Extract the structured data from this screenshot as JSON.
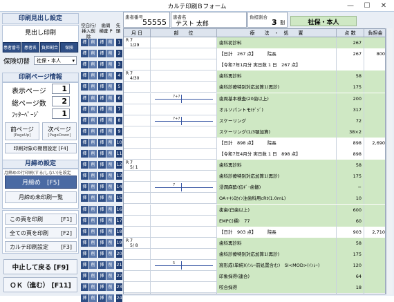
{
  "window": {
    "title": "カルテ印刷Ｂフォーム",
    "minimize": "—",
    "maximize": "☐",
    "close": "✕"
  },
  "left": {
    "sec1_title": "印刷見出し設定",
    "heading_print": "見出し印刷",
    "tabs": [
      "患者番号",
      "患者名",
      "負担割合",
      "保険"
    ],
    "insurance_switch_label": "保険切替",
    "insurance_value": "社保・本人",
    "sec2_title": "印刷ページ情報",
    "display_page_label": "表示ページ",
    "display_page": "1",
    "total_pages_label": "総ページ数",
    "total_pages": "2",
    "footer_page_label": "ﾌｯﾀｰﾍﾟｰｼﾞ",
    "footer_page": "1",
    "prev_label": "前ページ",
    "next_label": "次ページ",
    "prev_key": "[PageUp]",
    "next_key": "[PageDown]",
    "period_label": "印刷対象の期間設定 [F4]",
    "sec3_title": "月締め設定",
    "sec3_note": "月締めの行印刷(する/しない)を設定",
    "month_close": "月締め　[F5]",
    "month_close_list": "月締め未印刷一覧",
    "print_this": "この頁を印刷",
    "print_this_key": "[F1]",
    "print_all": "全ての頁を印刷",
    "print_all_key": "[F2]",
    "print_settings": "カルテ印刷設定",
    "print_settings_key": "[F3]",
    "cancel": "中止して戻る [F9]",
    "ok": "ＯＫ（進む） [F11]"
  },
  "side_header": {
    "blank_row": "空白行/",
    "insert_delete": "挿入削除",
    "tooth": "歯周",
    "check": "検査 P",
    "first_exam": "先 頭"
  },
  "side_buttons": {
    "insert": "挿",
    "delete": "削"
  },
  "patient": {
    "number_caption": "患者番号",
    "number": "55555",
    "name_caption": "患者名",
    "name": "テスト 太郎",
    "ratio_caption": "負担割合",
    "ratio": "3",
    "ratio_unit": "割",
    "insurance": "社保・本人"
  },
  "columns": {
    "day": "月 日",
    "part": "部　　位",
    "proc": "療　　法　・　処　　置",
    "points": "点 数",
    "fee": "負担金"
  },
  "rows": [
    {
      "n": "1",
      "date1": "R 7",
      "date2": "1/29",
      "proc": "歯科初診料",
      "pts": "267",
      "fee": "",
      "green": true,
      "tooth": ""
    },
    {
      "n": "2",
      "date1": "",
      "date2": "",
      "proc": "【日計　267 点】　　　院長",
      "pts": "267",
      "fee": "800",
      "green": false,
      "tooth": ""
    },
    {
      "n": "3",
      "date1": "",
      "date2": "",
      "proc": "【令和7年1月分 実日数 1 日　267 点】",
      "pts": "",
      "fee": "",
      "green": false,
      "tooth": ""
    },
    {
      "n": "4",
      "date1": "R 7",
      "date2": "4/30",
      "proc": "歯科再診料",
      "pts": "58",
      "fee": "",
      "green": true,
      "tooth": ""
    },
    {
      "n": "5",
      "date1": "",
      "date2": "",
      "proc": "歯科診療特別対応加算1(再診)",
      "pts": "175",
      "fee": "",
      "green": true,
      "tooth": ""
    },
    {
      "n": "6",
      "date1": "",
      "date2": "",
      "proc": "歯周基本検査(20歯以上)",
      "pts": "200",
      "fee": "",
      "green": true,
      "tooth": "7+7"
    },
    {
      "n": "7",
      "date1": "",
      "date2": "",
      "proc": "オルソパントモ(ﾃﾞｼﾞ)",
      "pts": "317",
      "fee": "",
      "green": true,
      "tooth": ""
    },
    {
      "n": "8",
      "date1": "",
      "date2": "",
      "proc": "スケーリング",
      "pts": "72",
      "fee": "",
      "green": true,
      "tooth": "7+7"
    },
    {
      "n": "9",
      "date1": "",
      "date2": "",
      "proc": "スケーリング(1/3顎加算)",
      "pts": "38×2",
      "fee": "",
      "green": true,
      "tooth": ""
    },
    {
      "n": "10",
      "date1": "",
      "date2": "",
      "proc": "【日計　898 点】　　　院長",
      "pts": "898",
      "fee": "2,690",
      "green": false,
      "tooth": ""
    },
    {
      "n": "11",
      "date1": "",
      "date2": "",
      "proc": "【令和7年4月分 実日数 1 日　898 点】",
      "pts": "898",
      "fee": "",
      "green": false,
      "tooth": ""
    },
    {
      "n": "12",
      "date1": "R 7",
      "date2": "5/ 1",
      "proc": "歯科再診料",
      "pts": "58",
      "fee": "",
      "green": true,
      "tooth": ""
    },
    {
      "n": "13",
      "date1": "",
      "date2": "",
      "proc": "歯科診療特別対応加算1(再診)",
      "pts": "175",
      "fee": "",
      "green": true,
      "tooth": ""
    },
    {
      "n": "14",
      "date1": "",
      "date2": "",
      "proc": "浸潤麻酔(伝ｷﾞ･歯髄)",
      "pts": "−",
      "fee": "",
      "green": true,
      "tooth": "7"
    },
    {
      "n": "15",
      "date1": "",
      "date2": "",
      "proc": "OA+ｷｼﾛｶｲﾝ注歯科用cRt(1.0mL)",
      "pts": "10",
      "fee": "",
      "green": true,
      "tooth": ""
    },
    {
      "n": "16",
      "date1": "",
      "date2": "",
      "proc": "抜歯(臼歯以上)",
      "pts": "600",
      "fee": "",
      "green": true,
      "tooth": ""
    },
    {
      "n": "17",
      "date1": "",
      "date2": "",
      "proc": "EMPC(標)　77",
      "pts": "60",
      "fee": "",
      "green": true,
      "tooth": ""
    },
    {
      "n": "18",
      "date1": "",
      "date2": "",
      "proc": "【日計　903 点】　　　院長",
      "pts": "903",
      "fee": "2,710",
      "green": false,
      "tooth": ""
    },
    {
      "n": "19",
      "date1": "R 7",
      "date2": "5/ 8",
      "proc": "歯科再診料",
      "pts": "58",
      "fee": "",
      "green": true,
      "tooth": ""
    },
    {
      "n": "20",
      "date1": "",
      "date2": "",
      "proc": "歯科診療特別対応加算1(再診)",
      "pts": "175",
      "fee": "",
      "green": true,
      "tooth": ""
    },
    {
      "n": "21",
      "date1": "",
      "date2": "",
      "proc": "窩形成(単純)(ｲﾝﾚｰ前処置含む)　SI<MOD>(ｲﾝﾚｰ)",
      "pts": "120",
      "fee": "",
      "green": true,
      "tooth": "5"
    },
    {
      "n": "22",
      "date1": "",
      "date2": "",
      "proc": "印象採得(連合)",
      "pts": "64",
      "fee": "",
      "green": true,
      "tooth": ""
    },
    {
      "n": "23",
      "date1": "",
      "date2": "",
      "proc": "咬合採得",
      "pts": "18",
      "fee": "",
      "green": true,
      "tooth": ""
    },
    {
      "n": "24",
      "date1": "",
      "date2": "",
      "proc": "【日計　435 点】　　　院長",
      "pts": "435",
      "fee": "1,310",
      "green": false,
      "tooth": ""
    }
  ],
  "colors": {
    "accent": "#2f4f86",
    "grid_green": "#cfe8c4"
  }
}
